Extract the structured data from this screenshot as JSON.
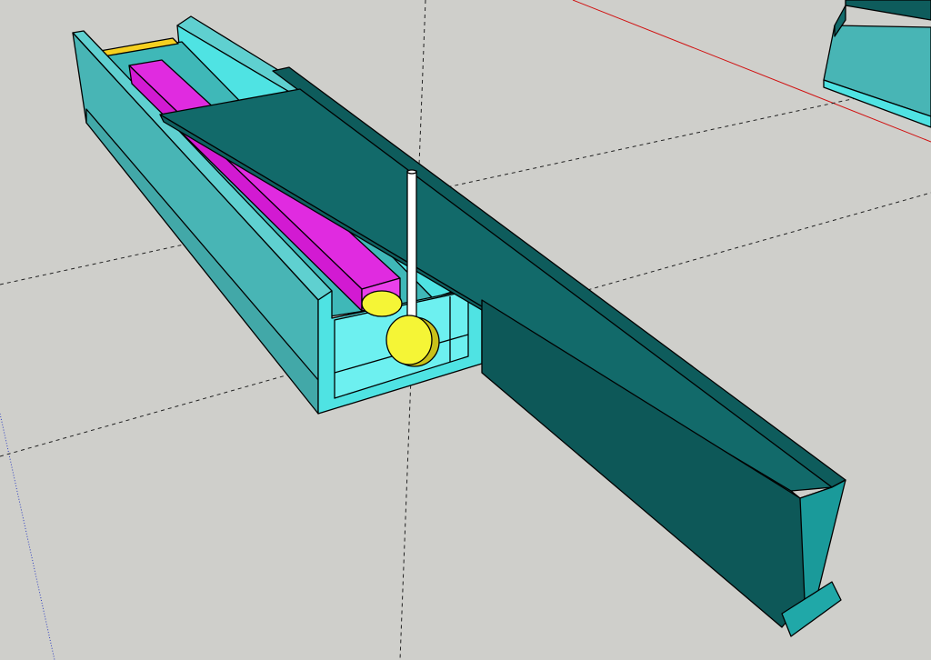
{
  "scene": {
    "background": "#cfcfcb",
    "colors": {
      "trough_light": "#4fe3e3",
      "trough_face": "#48b5b5",
      "trough_top": "#5fd0d0",
      "trough_inner": "#6df0f0",
      "rail_top": "#126a6a",
      "rail_side": "#0e5c5c",
      "rail_front": "#1a9a9a",
      "rod": "#d21ad2",
      "rod_top": "#e02be0",
      "disc": "#f5f536",
      "disc_dark": "#c9c11a",
      "post": "#ffffff",
      "axis_red": "#d01010",
      "axis_blue": "#3040c0",
      "guide_line": "#222222"
    },
    "objects": [
      "trough",
      "wedge-rail",
      "magenta-rod",
      "yellow-disc",
      "white-post",
      "partial-trough-top-right"
    ]
  }
}
